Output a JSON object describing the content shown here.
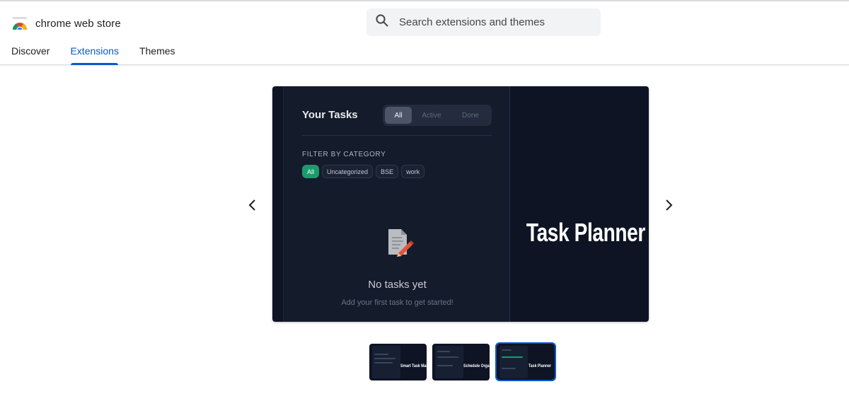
{
  "store": {
    "name": "chrome web store"
  },
  "search": {
    "placeholder": "Search extensions and themes"
  },
  "tabs": [
    {
      "label": "Discover",
      "active": false
    },
    {
      "label": "Extensions",
      "active": true
    },
    {
      "label": "Themes",
      "active": false
    }
  ],
  "colors": {
    "accent": "#0b57d0",
    "chip_active": "#1a9b6c",
    "slide_bg": "#0e1424"
  },
  "slide": {
    "panel_title": "Your Tasks",
    "segments": [
      "All",
      "Active",
      "Done"
    ],
    "filter_label": "FILTER BY CATEGORY",
    "chips": [
      "All",
      "Uncategorized",
      "BSE",
      "work"
    ],
    "empty_title": "No tasks yet",
    "empty_subtitle": "Add your first task to get started!",
    "hero_text": "Task Planner"
  },
  "thumbnails": [
    {
      "caption": "Smart Task Manager",
      "active": false
    },
    {
      "caption": "Schedule Organizer",
      "active": false
    },
    {
      "caption": "Task Planner",
      "active": true
    }
  ],
  "icons": {
    "prev": "chevron-left-icon",
    "next": "chevron-right-icon",
    "search": "search-icon",
    "empty": "document-pencil-icon",
    "logo": "chrome-web-store-logo"
  }
}
